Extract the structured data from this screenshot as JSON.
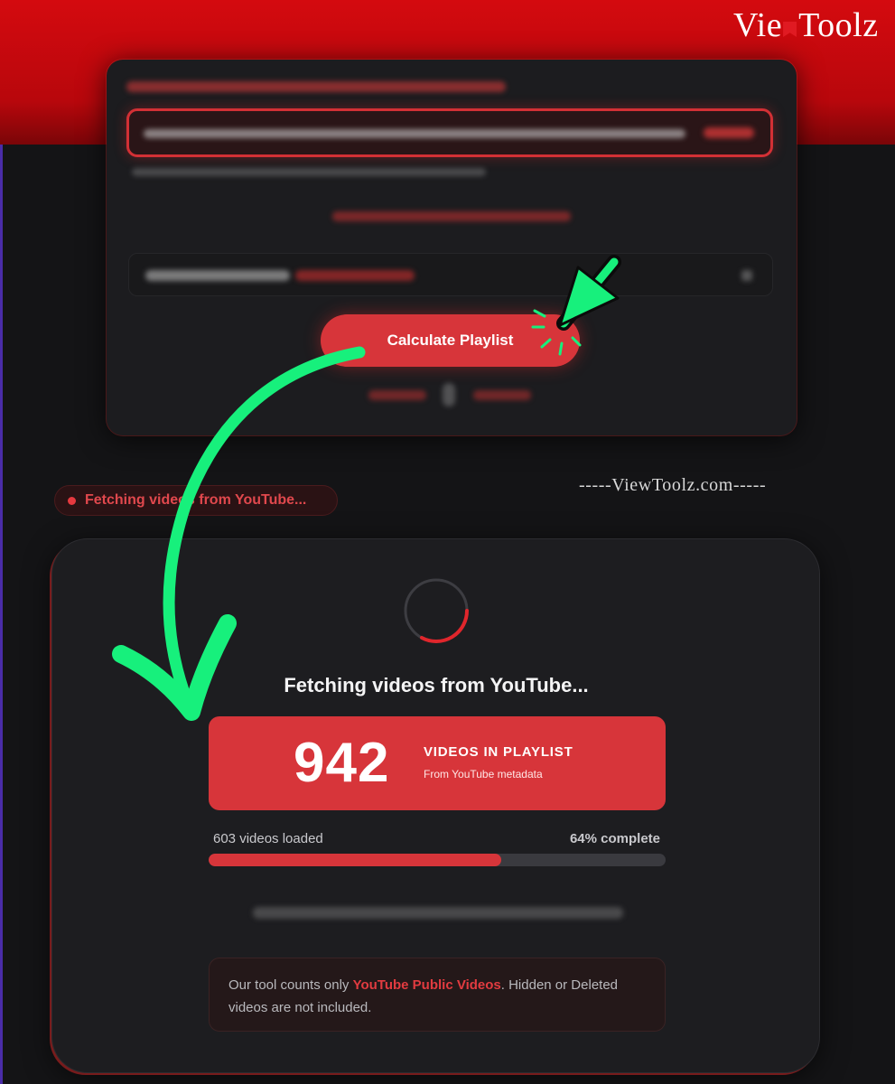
{
  "watermark": {
    "logo_before": "Vie",
    "logo_after": "Toolz",
    "site": "-----ViewToolz.com-----"
  },
  "form": {
    "calculate_label": "Calculate Playlist"
  },
  "status": {
    "pill_text": "Fetching videos from YouTube..."
  },
  "result": {
    "title": "Fetching videos from YouTube...",
    "count": "942",
    "count_label": "VIDEOS IN PLAYLIST",
    "count_sub": "From YouTube metadata",
    "loaded_text": "603 videos loaded",
    "percent_text": "64% complete",
    "progress_fraction": 0.64
  },
  "notice": {
    "before": "Our tool counts only ",
    "highlight": "YouTube Public Videos",
    "after": ". Hidden or Deleted videos are not included."
  },
  "colors": {
    "accent": "#d7353a",
    "arrow": "#17f07c",
    "background": "#141416"
  }
}
